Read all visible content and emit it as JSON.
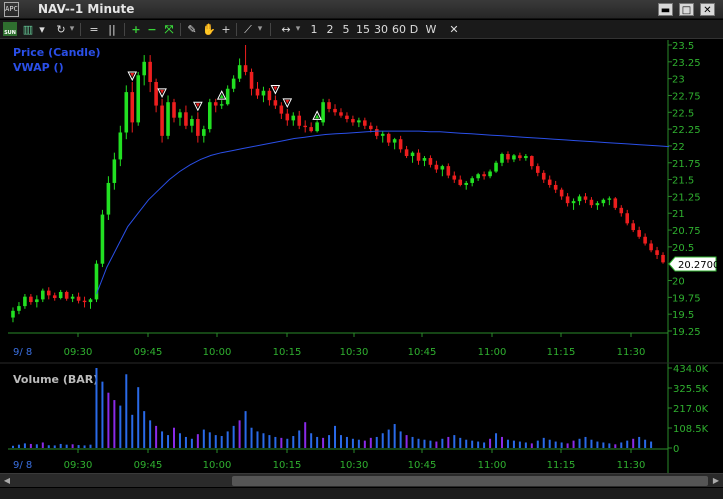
{
  "window": {
    "logo": "APC",
    "title": "NAV--1 Minute",
    "minimize": "▬",
    "maximize": "□",
    "close": "✕"
  },
  "toolbar": {
    "sun_label": "SUN",
    "intervals": [
      "1",
      "2",
      "5",
      "15",
      "30",
      "60",
      "D",
      "W"
    ],
    "close_label": "✕"
  },
  "price_panel": {
    "label_price": "Price (Candle)",
    "label_vwap": "VWAP ()",
    "last_price": "20.2700",
    "y_ticks": [
      "23.5",
      "23.25",
      "23",
      "22.75",
      "22.5",
      "22.25",
      "22",
      "21.75",
      "21.5",
      "21.25",
      "21",
      "20.75",
      "20.5",
      "20.25",
      "20",
      "19.75",
      "19.5",
      "19.25"
    ],
    "date_label": "9/ 8",
    "x_ticks": [
      "09:30",
      "09:45",
      "10:00",
      "10:15",
      "10:30",
      "10:45",
      "11:00",
      "11:15",
      "11:30"
    ]
  },
  "volume_panel": {
    "label": "Volume (BAR)",
    "y_ticks": [
      "434.0K",
      "325.5K",
      "217.0K",
      "108.5K",
      "0"
    ],
    "date_label": "9/ 8",
    "x_ticks": [
      "09:30",
      "09:45",
      "10:00",
      "10:15",
      "10:30",
      "10:45",
      "11:00",
      "11:15",
      "11:30"
    ]
  },
  "colors": {
    "up": "#22e022",
    "down": "#ee1e1e",
    "vwap": "#2a4fe8",
    "label_blue": "#2a4fe8",
    "axis_text": "#2fb02f",
    "price_tag_bg": "#ffffff"
  },
  "chart_data": {
    "type": "candlestick",
    "symbol": "NAV",
    "interval": "1 Minute",
    "price_range": [
      19.25,
      23.5
    ],
    "candles": [
      [
        19.45,
        19.6,
        19.38,
        19.55
      ],
      [
        19.55,
        19.68,
        19.5,
        19.62
      ],
      [
        19.62,
        19.8,
        19.58,
        19.76
      ],
      [
        19.76,
        19.8,
        19.64,
        19.68
      ],
      [
        19.68,
        19.78,
        19.6,
        19.72
      ],
      [
        19.72,
        19.88,
        19.68,
        19.85
      ],
      [
        19.85,
        19.9,
        19.72,
        19.78
      ],
      [
        19.78,
        19.82,
        19.7,
        19.74
      ],
      [
        19.74,
        19.86,
        19.72,
        19.83
      ],
      [
        19.83,
        19.85,
        19.7,
        19.73
      ],
      [
        19.73,
        19.8,
        19.68,
        19.76
      ],
      [
        19.76,
        19.82,
        19.66,
        19.7
      ],
      [
        19.7,
        19.76,
        19.6,
        19.68
      ],
      [
        19.68,
        19.74,
        19.58,
        19.72
      ],
      [
        19.72,
        20.3,
        19.68,
        20.25
      ],
      [
        20.25,
        21.05,
        20.2,
        20.98
      ],
      [
        20.98,
        21.55,
        20.9,
        21.45
      ],
      [
        21.45,
        21.9,
        21.35,
        21.8
      ],
      [
        21.8,
        22.3,
        21.7,
        22.2
      ],
      [
        22.2,
        22.9,
        22.1,
        22.8
      ],
      [
        22.8,
        22.95,
        22.2,
        22.35
      ],
      [
        22.35,
        23.1,
        22.3,
        23.05
      ],
      [
        23.05,
        23.35,
        22.9,
        23.25
      ],
      [
        23.25,
        23.35,
        22.8,
        22.95
      ],
      [
        22.95,
        23.0,
        22.5,
        22.6
      ],
      [
        22.6,
        22.7,
        22.05,
        22.15
      ],
      [
        22.15,
        22.75,
        22.1,
        22.65
      ],
      [
        22.65,
        22.7,
        22.35,
        22.42
      ],
      [
        22.42,
        22.55,
        22.3,
        22.5
      ],
      [
        22.5,
        22.6,
        22.25,
        22.3
      ],
      [
        22.3,
        22.45,
        22.2,
        22.4
      ],
      [
        22.4,
        22.5,
        22.05,
        22.15
      ],
      [
        22.15,
        22.3,
        22.05,
        22.25
      ],
      [
        22.25,
        22.7,
        22.2,
        22.65
      ],
      [
        22.65,
        22.7,
        22.5,
        22.6
      ],
      [
        22.6,
        22.68,
        22.55,
        22.62
      ],
      [
        22.62,
        22.9,
        22.6,
        22.85
      ],
      [
        22.85,
        23.05,
        22.8,
        23.0
      ],
      [
        23.0,
        23.3,
        22.95,
        23.2
      ],
      [
        23.2,
        23.5,
        23.05,
        23.1
      ],
      [
        23.1,
        23.15,
        22.75,
        22.85
      ],
      [
        22.85,
        22.95,
        22.7,
        22.75
      ],
      [
        22.75,
        22.88,
        22.65,
        22.82
      ],
      [
        22.82,
        22.86,
        22.6,
        22.68
      ],
      [
        22.68,
        22.75,
        22.55,
        22.6
      ],
      [
        22.6,
        22.65,
        22.4,
        22.48
      ],
      [
        22.48,
        22.55,
        22.3,
        22.38
      ],
      [
        22.38,
        22.5,
        22.3,
        22.45
      ],
      [
        22.45,
        22.52,
        22.25,
        22.3
      ],
      [
        22.3,
        22.38,
        22.2,
        22.28
      ],
      [
        22.28,
        22.35,
        22.2,
        22.22
      ],
      [
        22.22,
        22.38,
        22.2,
        22.35
      ],
      [
        22.35,
        22.7,
        22.3,
        22.65
      ],
      [
        22.65,
        22.7,
        22.5,
        22.55
      ],
      [
        22.55,
        22.62,
        22.45,
        22.5
      ],
      [
        22.5,
        22.56,
        22.42,
        22.45
      ],
      [
        22.45,
        22.5,
        22.35,
        22.4
      ],
      [
        22.4,
        22.45,
        22.3,
        22.35
      ],
      [
        22.35,
        22.42,
        22.28,
        22.38
      ],
      [
        22.38,
        22.42,
        22.25,
        22.3
      ],
      [
        22.3,
        22.35,
        22.2,
        22.25
      ],
      [
        22.25,
        22.3,
        22.1,
        22.15
      ],
      [
        22.15,
        22.22,
        22.05,
        22.18
      ],
      [
        22.18,
        22.2,
        22.0,
        22.05
      ],
      [
        22.05,
        22.12,
        21.95,
        22.1
      ],
      [
        22.1,
        22.15,
        21.9,
        21.95
      ],
      [
        21.95,
        22.0,
        21.82,
        21.85
      ],
      [
        21.85,
        21.92,
        21.75,
        21.9
      ],
      [
        21.9,
        21.95,
        21.72,
        21.78
      ],
      [
        21.78,
        21.85,
        21.7,
        21.82
      ],
      [
        21.82,
        21.86,
        21.68,
        21.72
      ],
      [
        21.72,
        21.78,
        21.6,
        21.65
      ],
      [
        21.65,
        21.72,
        21.55,
        21.7
      ],
      [
        21.7,
        21.74,
        21.52,
        21.56
      ],
      [
        21.56,
        21.62,
        21.45,
        21.5
      ],
      [
        21.5,
        21.56,
        21.4,
        21.42
      ],
      [
        21.42,
        21.48,
        21.35,
        21.45
      ],
      [
        21.45,
        21.55,
        21.4,
        21.52
      ],
      [
        21.52,
        21.6,
        21.48,
        21.58
      ],
      [
        21.58,
        21.62,
        21.5,
        21.55
      ],
      [
        21.55,
        21.65,
        21.52,
        21.62
      ],
      [
        21.62,
        21.78,
        21.6,
        21.75
      ],
      [
        21.75,
        21.9,
        21.7,
        21.88
      ],
      [
        21.88,
        21.92,
        21.75,
        21.8
      ],
      [
        21.8,
        21.88,
        21.76,
        21.86
      ],
      [
        21.86,
        21.9,
        21.78,
        21.82
      ],
      [
        21.82,
        21.88,
        21.78,
        21.85
      ],
      [
        21.85,
        21.86,
        21.65,
        21.7
      ],
      [
        21.7,
        21.74,
        21.55,
        21.6
      ],
      [
        21.6,
        21.64,
        21.45,
        21.5
      ],
      [
        21.5,
        21.56,
        21.38,
        21.42
      ],
      [
        21.42,
        21.48,
        21.3,
        21.35
      ],
      [
        21.35,
        21.38,
        21.2,
        21.25
      ],
      [
        21.25,
        21.3,
        21.1,
        21.15
      ],
      [
        21.15,
        21.22,
        21.05,
        21.18
      ],
      [
        21.18,
        21.28,
        21.12,
        21.25
      ],
      [
        21.25,
        21.3,
        21.15,
        21.2
      ],
      [
        21.2,
        21.24,
        21.08,
        21.12
      ],
      [
        21.12,
        21.18,
        21.05,
        21.15
      ],
      [
        21.15,
        21.22,
        21.1,
        21.2
      ],
      [
        21.2,
        21.25,
        21.12,
        21.22
      ],
      [
        21.22,
        21.24,
        21.05,
        21.08
      ],
      [
        21.08,
        21.12,
        20.95,
        21.0
      ],
      [
        21.0,
        21.05,
        20.82,
        20.85
      ],
      [
        20.85,
        20.9,
        20.72,
        20.75
      ],
      [
        20.75,
        20.8,
        20.62,
        20.65
      ],
      [
        20.65,
        20.7,
        20.52,
        20.55
      ],
      [
        20.55,
        20.6,
        20.42,
        20.45
      ],
      [
        20.45,
        20.5,
        20.32,
        20.38
      ],
      [
        20.38,
        20.42,
        20.25,
        20.27
      ]
    ],
    "vwap": [
      19.8,
      20.2,
      20.5,
      20.8,
      21.0,
      21.2,
      21.35,
      21.5,
      21.62,
      21.72,
      21.8,
      21.86,
      21.9,
      21.93,
      21.96,
      21.99,
      22.02,
      22.05,
      22.08,
      22.11,
      22.13,
      22.15,
      22.17,
      22.18,
      22.19,
      22.2,
      22.21,
      22.22,
      22.22,
      22.22,
      22.22,
      22.22,
      22.21,
      22.21,
      22.2,
      22.19,
      22.18,
      22.17,
      22.16,
      22.15,
      22.14,
      22.13,
      22.12,
      22.11,
      22.1,
      22.09,
      22.08,
      22.07,
      22.06,
      22.05,
      22.04,
      22.03,
      22.02,
      22.01,
      22.0,
      21.99
    ],
    "volume_range": [
      0,
      434000
    ],
    "volumes": [
      12,
      18,
      25,
      22,
      20,
      30,
      15,
      14,
      22,
      18,
      20,
      16,
      14,
      18,
      434,
      360,
      300,
      260,
      230,
      400,
      180,
      330,
      200,
      150,
      120,
      90,
      70,
      110,
      80,
      60,
      50,
      75,
      100,
      85,
      70,
      65,
      90,
      120,
      150,
      200,
      110,
      90,
      80,
      70,
      60,
      55,
      50,
      65,
      95,
      140,
      80,
      60,
      55,
      70,
      120,
      70,
      60,
      50,
      45,
      40,
      55,
      60,
      80,
      100,
      130,
      90,
      70,
      60,
      50,
      45,
      40,
      35,
      50,
      60,
      70,
      55,
      45,
      40,
      35,
      30,
      50,
      80,
      60,
      45,
      40,
      35,
      30,
      25,
      40,
      55,
      45,
      35,
      30,
      25,
      40,
      50,
      60,
      45,
      35,
      30,
      25,
      20,
      30,
      40,
      50,
      60,
      45,
      35
    ],
    "markers": [
      {
        "type": "sell",
        "index": 20
      },
      {
        "type": "sell",
        "index": 25
      },
      {
        "type": "sell",
        "index": 31
      },
      {
        "type": "buy",
        "index": 35
      },
      {
        "type": "sell",
        "index": 44
      },
      {
        "type": "sell",
        "index": 46
      },
      {
        "type": "buy",
        "index": 51
      }
    ]
  }
}
